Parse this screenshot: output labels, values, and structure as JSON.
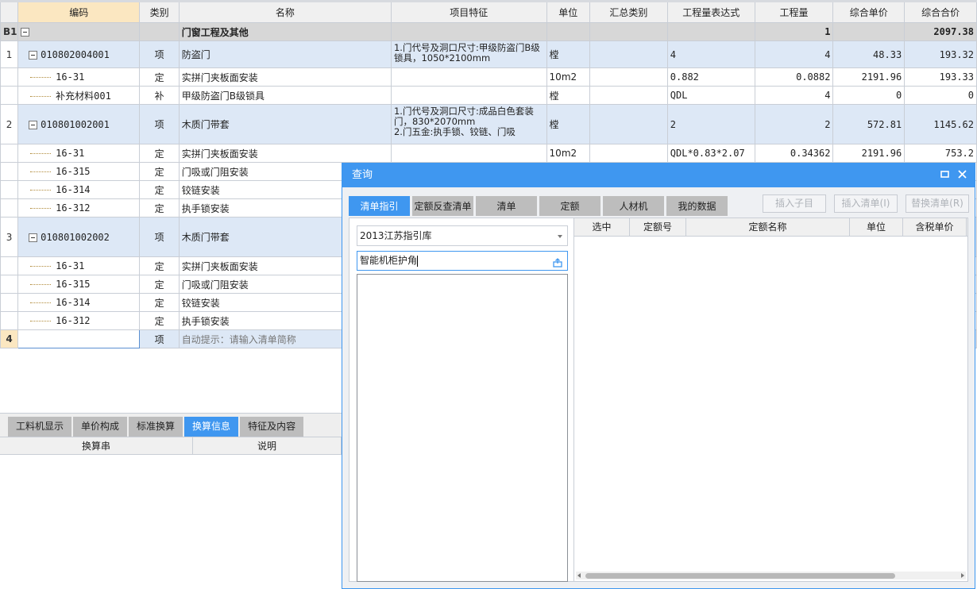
{
  "grid": {
    "headers": [
      "编码",
      "类别",
      "名称",
      "项目特征",
      "单位",
      "汇总类别",
      "工程量表达式",
      "工程量",
      "综合单价",
      "综合合价"
    ],
    "group": {
      "rownum": "B1",
      "name": "门窗工程及其他",
      "qty": "1",
      "total": "2097.38"
    },
    "rows": [
      {
        "kind": "item",
        "rownum": "1",
        "code": "010802004001",
        "type": "项",
        "name": "防盗门",
        "feature": "1.门代号及洞口尺寸:甲级防盗门B级锁具，1050*2100mm",
        "unit": "樘",
        "summary": "",
        "expr": "4",
        "qty": "4",
        "price": "48.33",
        "total": "193.32"
      },
      {
        "kind": "sub",
        "rownum": "",
        "code": "16-31",
        "type": "定",
        "name": "实拼门夹板面安装",
        "feature": "",
        "unit": "10m2",
        "summary": "",
        "expr": "0.882",
        "qty": "0.0882",
        "price": "2191.96",
        "total": "193.33"
      },
      {
        "kind": "sub",
        "rownum": "",
        "code": "补充材料001",
        "type": "补",
        "name": "甲级防盗门B级锁具",
        "feature": "",
        "unit": "樘",
        "summary": "",
        "expr": "QDL",
        "qty": "4",
        "price": "0",
        "total": "0"
      },
      {
        "kind": "item",
        "rownum": "2",
        "code": "010801002001",
        "type": "项",
        "name": "木质门带套",
        "feature": "1.门代号及洞口尺寸:成品白色套装门，830*2070mm\n2.门五金:执手锁、铰链、门吸",
        "unit": "樘",
        "summary": "",
        "expr": "2",
        "qty": "2",
        "price": "572.81",
        "total": "1145.62"
      },
      {
        "kind": "sub",
        "rownum": "",
        "code": "16-31",
        "type": "定",
        "name": "实拼门夹板面安装",
        "feature": "",
        "unit": "10m2",
        "summary": "",
        "expr": "QDL*0.83*2.07",
        "qty": "0.34362",
        "price": "2191.96",
        "total": "753.2"
      },
      {
        "kind": "sub",
        "rownum": "",
        "code": "16-315",
        "type": "定",
        "name": "门吸或门阻安装",
        "feature": "",
        "unit": "",
        "summary": "",
        "expr": "",
        "qty": "",
        "price": "",
        "total": ""
      },
      {
        "kind": "sub",
        "rownum": "",
        "code": "16-314",
        "type": "定",
        "name": "铰链安装",
        "feature": "",
        "unit": "",
        "summary": "",
        "expr": "",
        "qty": "",
        "price": "",
        "total": ""
      },
      {
        "kind": "sub",
        "rownum": "",
        "code": "16-312",
        "type": "定",
        "name": "执手锁安装",
        "feature": "",
        "unit": "",
        "summary": "",
        "expr": "",
        "qty": "",
        "price": "",
        "total": ""
      },
      {
        "kind": "item",
        "rownum": "3",
        "code": "010801002002",
        "type": "项",
        "name": "木质门带套",
        "feature": "",
        "unit": "",
        "summary": "",
        "expr": "",
        "qty": "",
        "price": "",
        "total": ""
      },
      {
        "kind": "sub",
        "rownum": "",
        "code": "16-31",
        "type": "定",
        "name": "实拼门夹板面安装",
        "feature": "",
        "unit": "",
        "summary": "",
        "expr": "",
        "qty": "",
        "price": "",
        "total": ""
      },
      {
        "kind": "sub",
        "rownum": "",
        "code": "16-315",
        "type": "定",
        "name": "门吸或门阻安装",
        "feature": "",
        "unit": "",
        "summary": "",
        "expr": "",
        "qty": "",
        "price": "",
        "total": ""
      },
      {
        "kind": "sub",
        "rownum": "",
        "code": "16-314",
        "type": "定",
        "name": "铰链安装",
        "feature": "",
        "unit": "",
        "summary": "",
        "expr": "",
        "qty": "",
        "price": "",
        "total": ""
      },
      {
        "kind": "sub",
        "rownum": "",
        "code": "16-312",
        "type": "定",
        "name": "执手锁安装",
        "feature": "",
        "unit": "",
        "summary": "",
        "expr": "",
        "qty": "",
        "price": "",
        "total": ""
      }
    ],
    "newrow": {
      "rownum": "4",
      "type": "项",
      "hint": "自动提示：请输入清单简称"
    }
  },
  "bottom_panel": {
    "tabs": [
      "工料机显示",
      "单价构成",
      "标准换算",
      "换算信息",
      "特征及内容"
    ],
    "active_tab": "换算信息",
    "columns": [
      "换算串",
      "说明"
    ]
  },
  "dialog": {
    "title": "查询",
    "tabs": [
      "清单指引",
      "定额反查清单",
      "清单",
      "定额",
      "人材机",
      "我的数据"
    ],
    "active_tab": "清单指引",
    "buttons": [
      "插入子目",
      "插入清单(I)",
      "替换清单(R)"
    ],
    "library_select": "2013江苏指引库",
    "search_value": "智能机柜护角",
    "result_columns": [
      "选中",
      "定额号",
      "定额名称",
      "单位",
      "含税单价"
    ],
    "colors": {
      "accent": "#3f97f0",
      "item_row": "#dde8f6",
      "group_row": "#d7d7d7"
    }
  }
}
